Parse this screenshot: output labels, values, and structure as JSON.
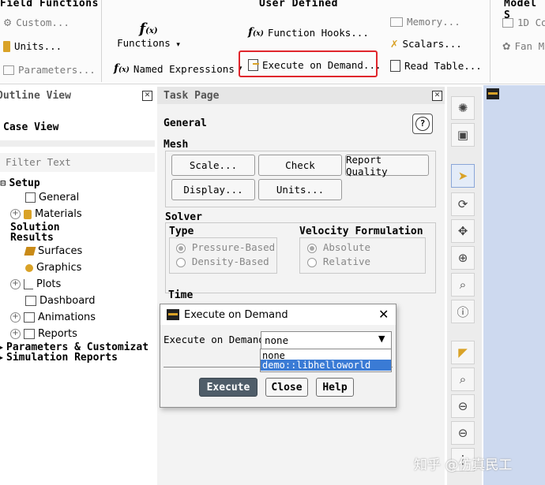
{
  "ribbon": {
    "field_functions": {
      "title": "Field Functions",
      "custom": "Custom...",
      "units": "Units...",
      "parameters": "Parameters..."
    },
    "user_defined": {
      "title": "User Defined",
      "functions": "Functions",
      "named_expressions": "Named Expressions",
      "function_hooks": "Function Hooks...",
      "execute_on_demand": "Execute on Demand...",
      "memory": "Memory...",
      "scalars": "Scalars...",
      "read_table": "Read Table..."
    },
    "model": {
      "title": "Model S",
      "item1": "1D Co",
      "item2": "Fan M"
    }
  },
  "outline": {
    "title": "Outline View",
    "case_view": "Case View",
    "filter_placeholder": "Filter Text",
    "setup": "Setup",
    "general": "General",
    "materials": "Materials",
    "solution": "Solution",
    "results": "Results",
    "surfaces": "Surfaces",
    "graphics": "Graphics",
    "plots": "Plots",
    "dashboard": "Dashboard",
    "animations": "Animations",
    "reports": "Reports",
    "parameters": "Parameters & Customizat",
    "simulation_reports": "Simulation Reports"
  },
  "task": {
    "title": "Task Page",
    "section": "General",
    "help": "?",
    "mesh": "Mesh",
    "scale": "Scale...",
    "check": "Check",
    "report_quality": "Report Quality",
    "display": "Display...",
    "units": "Units...",
    "solver": "Solver",
    "type": "Type",
    "pressure_based": "Pressure-Based",
    "density_based": "Density-Based",
    "velocity_formulation": "Velocity Formulation",
    "absolute": "Absolute",
    "relative": "Relative",
    "time": "Time"
  },
  "dialog": {
    "title": "Execute on Demand",
    "label": "Execute on Demand",
    "selected": "none",
    "options": [
      "none",
      "demo::libhelloworld"
    ],
    "execute": "Execute",
    "close": "Close",
    "help": "Help"
  },
  "watermark": "知乎 @仿真民工",
  "colors": {
    "highlight": "#e0262c",
    "selection": "#3a7bd5",
    "graphics_bg": "#cdd9ef"
  }
}
